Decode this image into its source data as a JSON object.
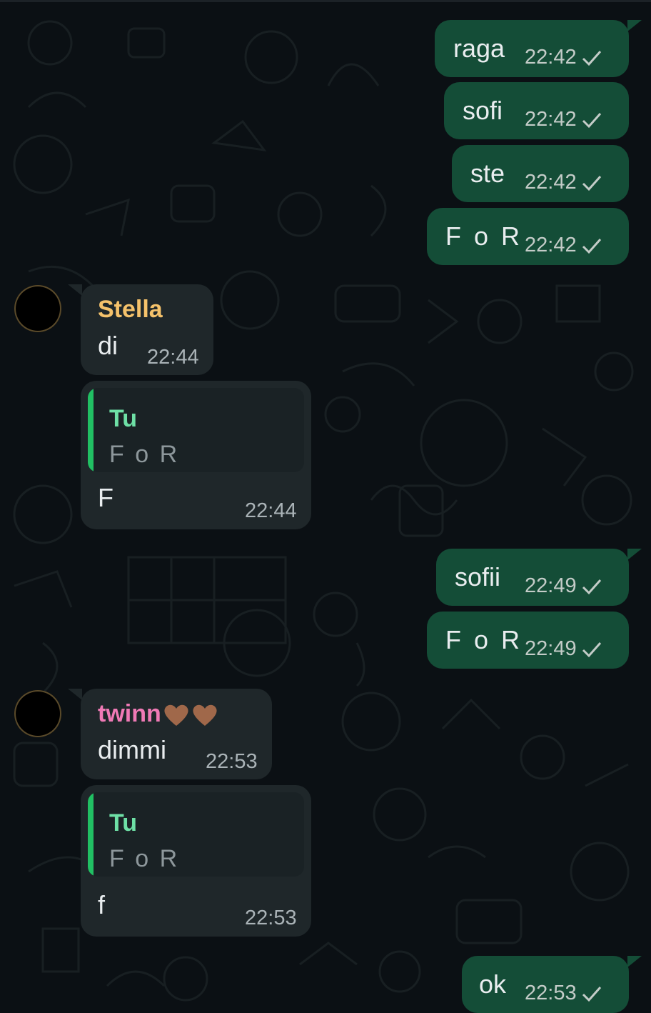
{
  "chat": {
    "messages": [
      {
        "id": "m1",
        "direction": "out",
        "text": "raga",
        "time": "22:42",
        "status": "sent-check-icon"
      },
      {
        "id": "m2",
        "direction": "out",
        "text": "sofi",
        "time": "22:42",
        "status": "sent-check-icon"
      },
      {
        "id": "m3",
        "direction": "out",
        "text": "ste",
        "time": "22:42",
        "status": "sent-check-icon"
      },
      {
        "id": "m4",
        "direction": "out",
        "text": "F o R",
        "time": "22:42",
        "status": "sent-check-icon"
      },
      {
        "id": "m5",
        "direction": "in",
        "sender": "Stella",
        "text": "di",
        "time": "22:44"
      },
      {
        "id": "m6",
        "direction": "in",
        "quote": {
          "author": "Tu",
          "text": "F o R"
        },
        "text": "F",
        "time": "22:44"
      },
      {
        "id": "m7",
        "direction": "out",
        "text": "sofii",
        "time": "22:49",
        "status": "sent-check-icon"
      },
      {
        "id": "m8",
        "direction": "out",
        "text": "F o R",
        "time": "22:49",
        "status": "sent-check-icon"
      },
      {
        "id": "m9",
        "direction": "in",
        "sender": "twinn",
        "sender_emoji": [
          "brown-heart-icon",
          "brown-heart-icon"
        ],
        "text": "dimmi",
        "time": "22:53"
      },
      {
        "id": "m10",
        "direction": "in",
        "quote": {
          "author": "Tu",
          "text": "F o R"
        },
        "text": "f",
        "time": "22:53"
      },
      {
        "id": "m11",
        "direction": "out",
        "text": "ok",
        "time": "22:53",
        "status": "sent-check-icon"
      }
    ]
  },
  "colors": {
    "background": "#0b1014",
    "outgoing_bubble": "#144d37",
    "incoming_bubble": "#1f272a",
    "quote_accent": "#21c063",
    "sender_stella": "#f5c26b",
    "sender_twinn": "#f07ab6"
  }
}
